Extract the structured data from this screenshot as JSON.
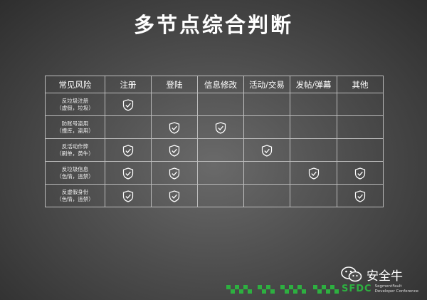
{
  "slide": {
    "title": "多节点综合判断"
  },
  "table": {
    "headers": [
      "常见风险",
      "注册",
      "登陆",
      "信息修改",
      "活动/交易",
      "发帖/弹幕",
      "其他"
    ],
    "rows": [
      {
        "label": [
          "反垃圾注册",
          "（虚假，垃圾）"
        ],
        "checks": [
          true,
          false,
          false,
          false,
          false,
          false
        ]
      },
      {
        "label": [
          "防账号盗用",
          "（撞库，盗用）"
        ],
        "checks": [
          false,
          true,
          true,
          false,
          false,
          false
        ]
      },
      {
        "label": [
          "反活动作弊",
          "（刷单，黄牛）"
        ],
        "checks": [
          true,
          true,
          false,
          true,
          false,
          false
        ]
      },
      {
        "label": [
          "反垃圾信息",
          "（色情，违禁）"
        ],
        "checks": [
          true,
          true,
          false,
          false,
          true,
          true
        ]
      },
      {
        "label": [
          "反虚假身份",
          "（色情，违禁）"
        ],
        "checks": [
          true,
          true,
          false,
          false,
          false,
          true
        ]
      }
    ]
  },
  "icons": {
    "check": "shield-check-icon",
    "wechat": "wechat-icon"
  },
  "footer": {
    "brand": "安全牛",
    "sfdc": "SFDC",
    "sfdc_sub1": "SegmentFault",
    "sfdc_sub2": "Developer Conference"
  },
  "colors": {
    "accent_green": "#2db040",
    "table_border": "#bdbdbd"
  }
}
